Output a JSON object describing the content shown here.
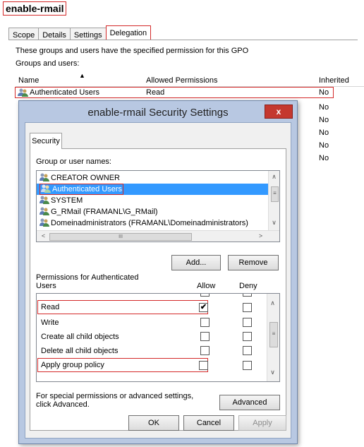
{
  "gpo_title": "enable-rmail",
  "tabs": [
    {
      "label": "Scope"
    },
    {
      "label": "Details"
    },
    {
      "label": "Settings"
    },
    {
      "label": "Delegation"
    }
  ],
  "delegation": {
    "description": "These groups and users have the specified permission for this GPO",
    "groups_label": "Groups and users:",
    "columns": {
      "name": "Name",
      "allowed": "Allowed Permissions",
      "inherited": "Inherited"
    },
    "rows": [
      {
        "name": "Authenticated Users",
        "allowed": "Read",
        "inherited": "No"
      },
      {
        "inherited": "No"
      },
      {
        "inherited": "No"
      },
      {
        "inherited": "No"
      },
      {
        "inherited": "No"
      },
      {
        "inherited": "No"
      }
    ]
  },
  "dialog": {
    "title": "enable-rmail Security Settings",
    "close_label": "x",
    "security_tab": "Security",
    "group_label": "Group or user names:",
    "users": [
      {
        "name": "CREATOR OWNER"
      },
      {
        "name": "Authenticated Users",
        "selected": true
      },
      {
        "name": "SYSTEM"
      },
      {
        "name": "G_RMail (FRAMANL\\G_RMail)"
      },
      {
        "name": "Domeinadministrators (FRAMANL\\Domeinadministrators)"
      }
    ],
    "add_button": "Add...",
    "remove_button": "Remove",
    "perm_label_line1": "Permissions for Authenticated",
    "perm_label_line2": "Users",
    "allow_header": "Allow",
    "deny_header": "Deny",
    "permissions": [
      {
        "name": "Read",
        "allow": true,
        "deny": false
      },
      {
        "name": "Write",
        "allow": false,
        "deny": false
      },
      {
        "name": "Create all child objects",
        "allow": false,
        "deny": false
      },
      {
        "name": "Delete all child objects",
        "allow": false,
        "deny": false
      },
      {
        "name": "Apply group policy",
        "allow": false,
        "deny": false
      }
    ],
    "special_line1": "For special permissions or advanced settings,",
    "special_line2": "click Advanced.",
    "advanced_button": "Advanced",
    "ok_button": "OK",
    "cancel_button": "Cancel",
    "apply_button": "Apply",
    "hscroll_glyph": "III",
    "check_glyph": "✔"
  }
}
